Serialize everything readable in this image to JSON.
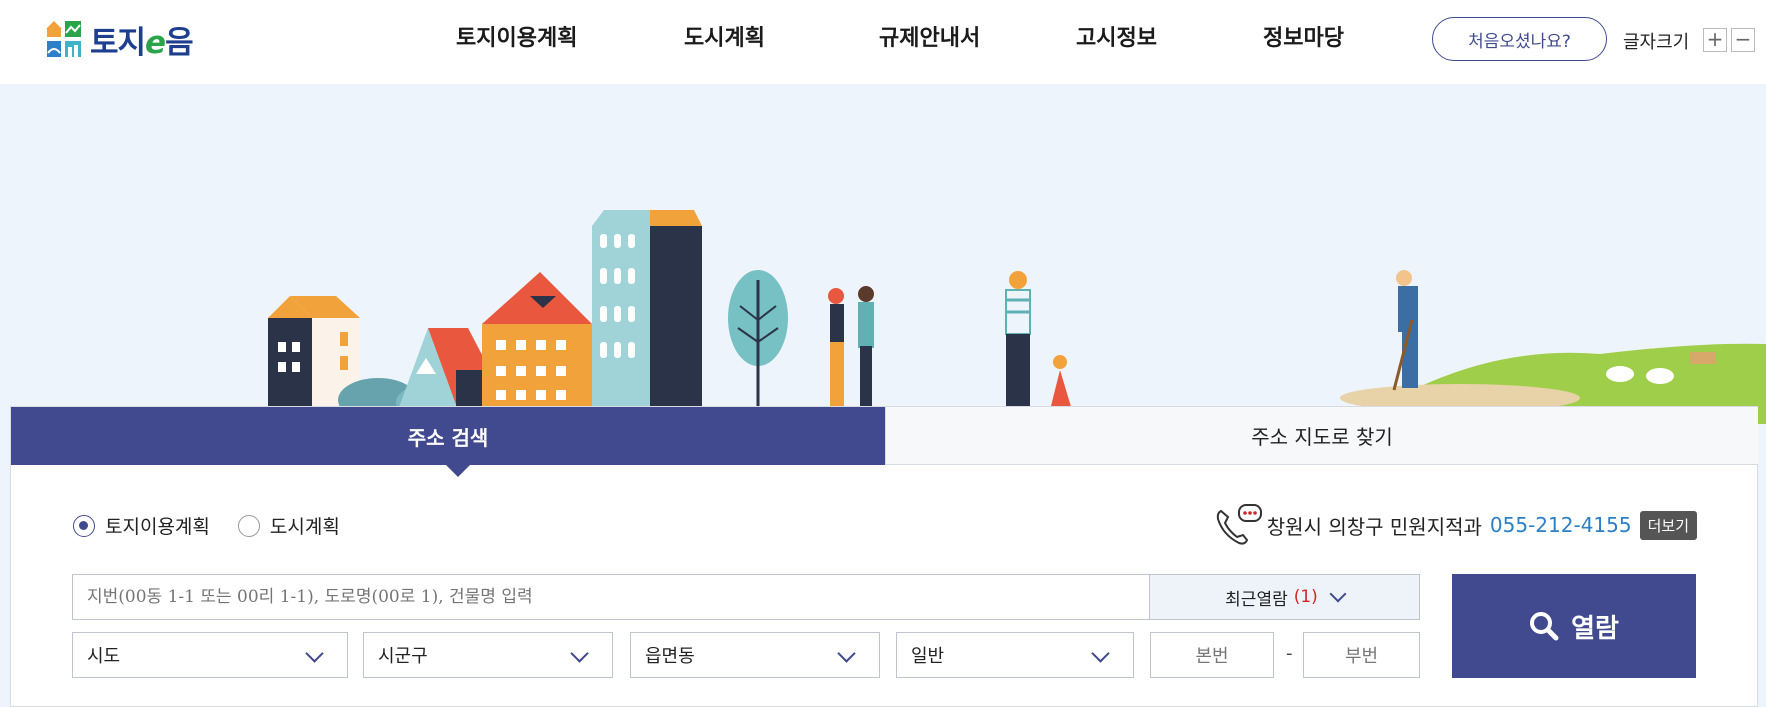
{
  "header": {
    "logo_text_prefix": "토지",
    "logo_text_e": "e",
    "logo_text_suffix": "음",
    "nav": [
      "토지이용계획",
      "도시계획",
      "규제안내서",
      "고시정보",
      "정보마당"
    ],
    "first_visit_button": "처음오셨나요?",
    "font_size_label": "글자크기",
    "font_plus": "+",
    "font_minus": "−"
  },
  "search": {
    "tabs": [
      {
        "label": "주소 검색",
        "active": true
      },
      {
        "label": "주소 지도로 찾기",
        "active": false
      }
    ],
    "radios": [
      {
        "label": "토지이용계획",
        "checked": true
      },
      {
        "label": "도시계획",
        "checked": false
      }
    ],
    "contact": {
      "text": "창원시 의창구 민원지적과",
      "phone": "055-212-4155",
      "more": "더보기"
    },
    "input_placeholder": "지번(00동 1-1 또는 00리 1-1), 도로명(00로 1), 건물명 입력",
    "recent_label": "최근열람",
    "recent_count": "(1)",
    "selects": [
      "시도",
      "시군구",
      "읍면동",
      "일반"
    ],
    "main_number_placeholder": "본번",
    "dash": "-",
    "sub_number_placeholder": "부번",
    "view_button": "열람"
  },
  "colors": {
    "primary": "#414a8e",
    "phone": "#2d80c5",
    "count": "#d32626",
    "hero_bg": "#eef4fc"
  },
  "icons": [
    "home-logo-icon",
    "phone-chat-icon",
    "search-icon",
    "chevron-down-icon"
  ]
}
